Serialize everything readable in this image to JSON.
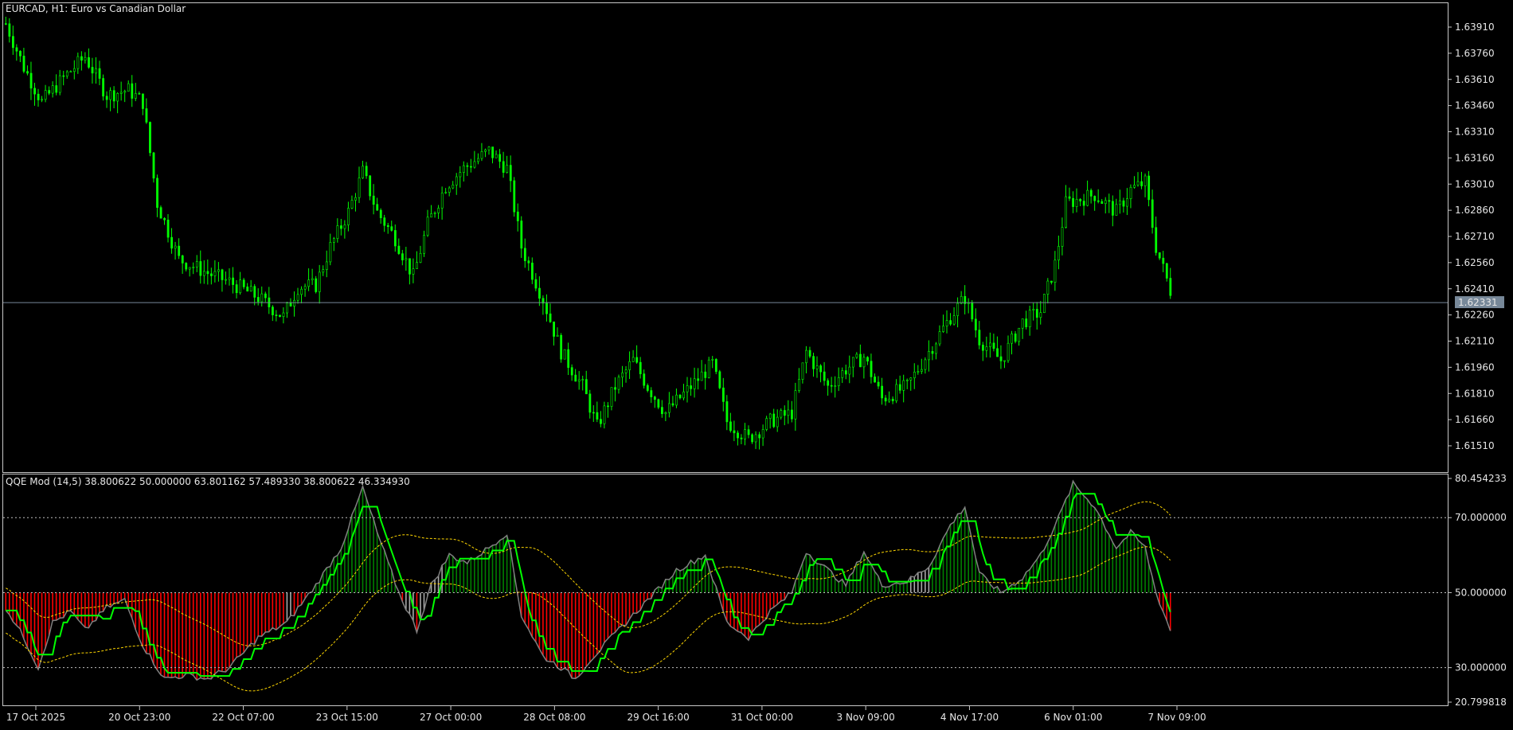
{
  "main_chart": {
    "symbol": "EURCAD",
    "timeframe": "H1",
    "title": "EURCAD, H1:  Euro vs Canadian Dollar",
    "price_ticks": [
      "1.63910",
      "1.63760",
      "1.63610",
      "1.63460",
      "1.63310",
      "1.63160",
      "1.63010",
      "1.62860",
      "1.62710",
      "1.62560",
      "1.62410",
      "1.62260",
      "1.62110",
      "1.61960",
      "1.61810",
      "1.61660",
      "1.61510"
    ],
    "current_price": "1.62331",
    "colors": {
      "background": "#000000",
      "bull_candle": "#00ff00",
      "bear_candle": "#00ff00",
      "grid": "#c0c0c0",
      "current_price_line": "#778899",
      "axis_text": "#e6e6e6"
    }
  },
  "indicator": {
    "label": "QQE Mod (14,5) 38.800622 50.000000 63.801162 57.489330 38.800622 46.334930",
    "scale_ticks": [
      "80.454233",
      "70.000000",
      "50.000000",
      "30.000000",
      "20.799818"
    ],
    "levels": [
      70,
      50,
      30
    ],
    "colors": {
      "hist_up": "#008000",
      "hist_down": "#ff0000",
      "hist_neutral": "#a9a9a9",
      "rsi_line": "#00ff00",
      "band": "#ffd700",
      "outline": "#808080"
    }
  },
  "time_axis": {
    "labels": [
      "17 Oct 2025",
      "20 Oct 23:00",
      "22 Oct 07:00",
      "23 Oct 15:00",
      "27 Oct 00:00",
      "28 Oct 08:00",
      "29 Oct 16:00",
      "31 Oct 00:00",
      "3 Nov 09:00",
      "4 Nov 17:00",
      "6 Nov 01:00",
      "7 Nov 09:00"
    ]
  },
  "chart_data": [
    {
      "type": "candlestick",
      "title": "EURCAD, H1:  Euro vs Canadian Dollar",
      "x_start": "17 Oct 2025",
      "ylim": [
        1.6145,
        1.6405
      ],
      "path_points": [
        [
          0,
          1.6393
        ],
        [
          5,
          1.6368
        ],
        [
          10,
          1.6348
        ],
        [
          16,
          1.6362
        ],
        [
          22,
          1.6374
        ],
        [
          28,
          1.6352
        ],
        [
          34,
          1.6355
        ],
        [
          38,
          1.6348
        ],
        [
          42,
          1.629
        ],
        [
          48,
          1.6258
        ],
        [
          56,
          1.625
        ],
        [
          62,
          1.6245
        ],
        [
          70,
          1.6236
        ],
        [
          77,
          1.6225
        ],
        [
          81,
          1.6242
        ],
        [
          86,
          1.6243
        ],
        [
          90,
          1.6265
        ],
        [
          95,
          1.6285
        ],
        [
          99,
          1.6308
        ],
        [
          103,
          1.6285
        ],
        [
          108,
          1.627
        ],
        [
          113,
          1.6248
        ],
        [
          117,
          1.6278
        ],
        [
          122,
          1.63
        ],
        [
          127,
          1.631
        ],
        [
          134,
          1.632
        ],
        [
          139,
          1.631
        ],
        [
          143,
          1.6265
        ],
        [
          149,
          1.6235
        ],
        [
          154,
          1.6205
        ],
        [
          160,
          1.6185
        ],
        [
          164,
          1.6162
        ],
        [
          169,
          1.6185
        ],
        [
          174,
          1.62
        ],
        [
          178,
          1.6185
        ],
        [
          183,
          1.617
        ],
        [
          190,
          1.6185
        ],
        [
          196,
          1.6198
        ],
        [
          200,
          1.6165
        ],
        [
          206,
          1.6155
        ],
        [
          212,
          1.6165
        ],
        [
          218,
          1.617
        ],
        [
          222,
          1.6205
        ],
        [
          228,
          1.6185
        ],
        [
          233,
          1.6195
        ],
        [
          238,
          1.6202
        ],
        [
          243,
          1.6178
        ],
        [
          250,
          1.6185
        ],
        [
          256,
          1.6205
        ],
        [
          262,
          1.6225
        ],
        [
          266,
          1.6236
        ],
        [
          270,
          1.6212
        ],
        [
          276,
          1.62
        ],
        [
          282,
          1.6222
        ],
        [
          287,
          1.6228
        ],
        [
          291,
          1.6255
        ],
        [
          294,
          1.629
        ],
        [
          302,
          1.6295
        ],
        [
          308,
          1.6285
        ],
        [
          312,
          1.6298
        ],
        [
          316,
          1.6302
        ],
        [
          319,
          1.6265
        ],
        [
          323,
          1.624
        ]
      ]
    },
    {
      "type": "line",
      "title": "QQE Mod (14,5)",
      "ylim": [
        20.799818,
        80.454233
      ],
      "series": [
        {
          "name": "histogram",
          "points": [
            [
              0,
              46
            ],
            [
              5,
              38
            ],
            [
              9,
              30
            ],
            [
              13,
              42
            ],
            [
              18,
              45
            ],
            [
              22,
              40
            ],
            [
              28,
              46
            ],
            [
              33,
              48
            ],
            [
              38,
              36
            ],
            [
              44,
              27
            ],
            [
              50,
              28
            ],
            [
              56,
              27
            ],
            [
              62,
              30
            ],
            [
              66,
              34
            ],
            [
              70,
              38
            ],
            [
              78,
              42
            ],
            [
              86,
              52
            ],
            [
              93,
              62
            ],
            [
              99,
              78
            ],
            [
              103,
              66
            ],
            [
              109,
              50
            ],
            [
              114,
              40
            ],
            [
              118,
              52
            ],
            [
              123,
              60
            ],
            [
              128,
              58
            ],
            [
              134,
              62
            ],
            [
              139,
              66
            ],
            [
              143,
              44
            ],
            [
              149,
              33
            ],
            [
              154,
              30
            ],
            [
              158,
              27
            ],
            [
              162,
              32
            ],
            [
              168,
              38
            ],
            [
              174,
              44
            ],
            [
              180,
              50
            ],
            [
              186,
              56
            ],
            [
              194,
              60
            ],
            [
              200,
              42
            ],
            [
              206,
              38
            ],
            [
              212,
              45
            ],
            [
              218,
              50
            ],
            [
              222,
              61
            ],
            [
              228,
              56
            ],
            [
              233,
              52
            ],
            [
              238,
              61
            ],
            [
              243,
              52
            ],
            [
              250,
              53
            ],
            [
              256,
              57
            ],
            [
              262,
              68
            ],
            [
              266,
              73
            ],
            [
              270,
              55
            ],
            [
              276,
              50
            ],
            [
              282,
              54
            ],
            [
              287,
              60
            ],
            [
              292,
              70
            ],
            [
              296,
              79
            ],
            [
              302,
              73
            ],
            [
              308,
              62
            ],
            [
              312,
              66
            ],
            [
              316,
              62
            ],
            [
              319,
              50
            ],
            [
              323,
              40
            ]
          ]
        }
      ]
    }
  ]
}
